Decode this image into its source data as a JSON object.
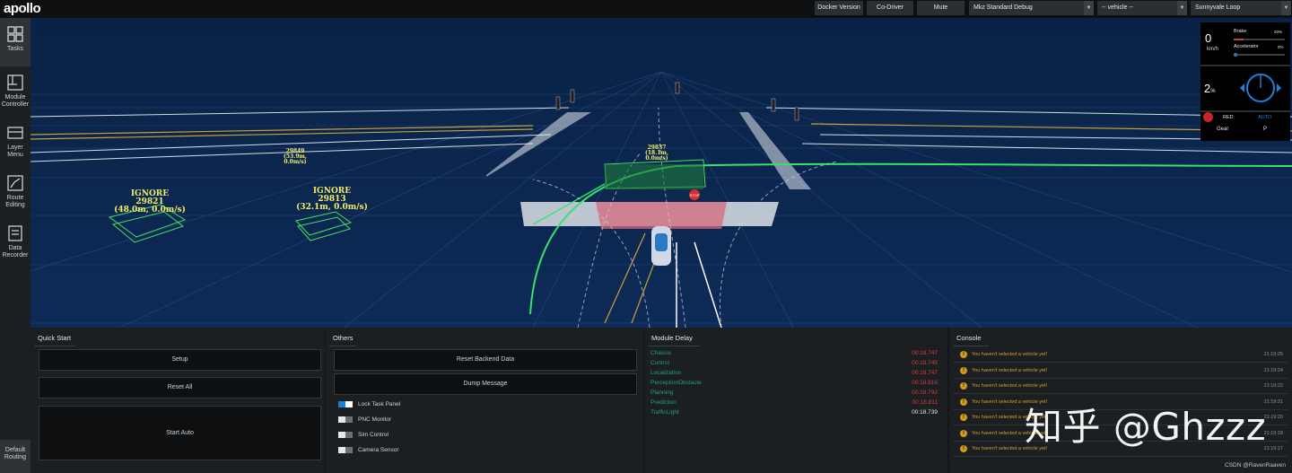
{
  "header": {
    "logo": "apollo",
    "docker_version": "Docker Version",
    "co_driver": "Co-Driver",
    "mute": "Mute",
    "mode_select": "Mkz Standard Debug",
    "vehicle_select": "-- vehicle --",
    "map_select": "Sunnyvale Loop"
  },
  "sidebar": {
    "items": [
      {
        "label": "Tasks",
        "icon": "grid-icon"
      },
      {
        "label": "Module Controller",
        "icon": "module-controller-icon"
      },
      {
        "label": "Layer Menu",
        "icon": "layer-menu-icon"
      },
      {
        "label": "Route Editing",
        "icon": "route-editing-icon"
      },
      {
        "label": "Data Recorder",
        "icon": "data-recorder-icon"
      }
    ],
    "bottom": "Default Routing"
  },
  "scene": {
    "obstacles": [
      {
        "l1": "IGNORE",
        "l2": "29821",
        "l3": "(48.0m, 0.0m/s)"
      },
      {
        "l1": "IGNORE",
        "l2": "29813",
        "l3": "(32.1m, 0.0m/s)"
      },
      {
        "l1": "29849",
        "l2": "(53.9m, 0.0m/s)"
      },
      {
        "l1": "29837",
        "l2": "(18.1m, 0.0m/s)"
      }
    ],
    "stop_sign": "STOP"
  },
  "dashboard": {
    "speed": "0",
    "speed_unit": "km/h",
    "brake_label": "Brake",
    "brake_value": "20%",
    "brake_fraction": 0.2,
    "accel_label": "Accelerator",
    "accel_value": "0%",
    "accel_fraction": 0.0,
    "steering": "2",
    "steering_unit": "%",
    "signal": "RED",
    "drive_mode": "AUTO",
    "gear_label": "Gear",
    "gear_value": "P"
  },
  "quick_start": {
    "title": "Quick Start",
    "setup": "Setup",
    "reset_all": "Reset All",
    "start_auto": "Start Auto",
    "default_routing": "Default Routing"
  },
  "others": {
    "title": "Others",
    "reset_backend": "Reset Backend Data",
    "dump_message": "Dump Message",
    "toggles": [
      {
        "label": "Lock Task Panel",
        "on": true
      },
      {
        "label": "PNC Monitor",
        "on": false
      },
      {
        "label": "Sim Control",
        "on": false
      },
      {
        "label": "Camera Sensor",
        "on": false
      }
    ]
  },
  "module_delay": {
    "title": "Module Delay",
    "rows": [
      {
        "name": "Chassis",
        "value": "00:18.747",
        "warn": true
      },
      {
        "name": "Control",
        "value": "00:18.745",
        "warn": true
      },
      {
        "name": "Localization",
        "value": "00:18.747",
        "warn": true
      },
      {
        "name": "PerceptionObstacle",
        "value": "00:18.816",
        "warn": true
      },
      {
        "name": "Planning",
        "value": "00:18.792",
        "warn": true
      },
      {
        "name": "Prediction",
        "value": "00:18.811",
        "warn": true
      },
      {
        "name": "TrafficLight",
        "value": "00:18.739",
        "warn": false
      }
    ]
  },
  "console": {
    "title": "Console",
    "rows": [
      {
        "msg": "You haven't selected a vehicle yet!",
        "time": "21:19:25"
      },
      {
        "msg": "You haven't selected a vehicle yet!",
        "time": "21:19:24"
      },
      {
        "msg": "You haven't selected a vehicle yet!",
        "time": "21:19:22"
      },
      {
        "msg": "You haven't selected a vehicle yet!",
        "time": "21:19:21"
      },
      {
        "msg": "You haven't selected a vehicle yet!",
        "time": "21:19:20"
      },
      {
        "msg": "You haven't selected a vehicle yet!",
        "time": "21:19:18"
      },
      {
        "msg": "You haven't selected a vehicle yet!",
        "time": "21:19:17"
      }
    ]
  },
  "watermark": "知乎 @Ghzzz",
  "credit": "CSDN @RavenRaaven",
  "colors": {
    "sky": "#061a3a",
    "accent_blue": "#1e7fd4",
    "delay_red": "#d33d3d",
    "module_green": "#1f9e88",
    "console_warn": "#d6a21e"
  }
}
